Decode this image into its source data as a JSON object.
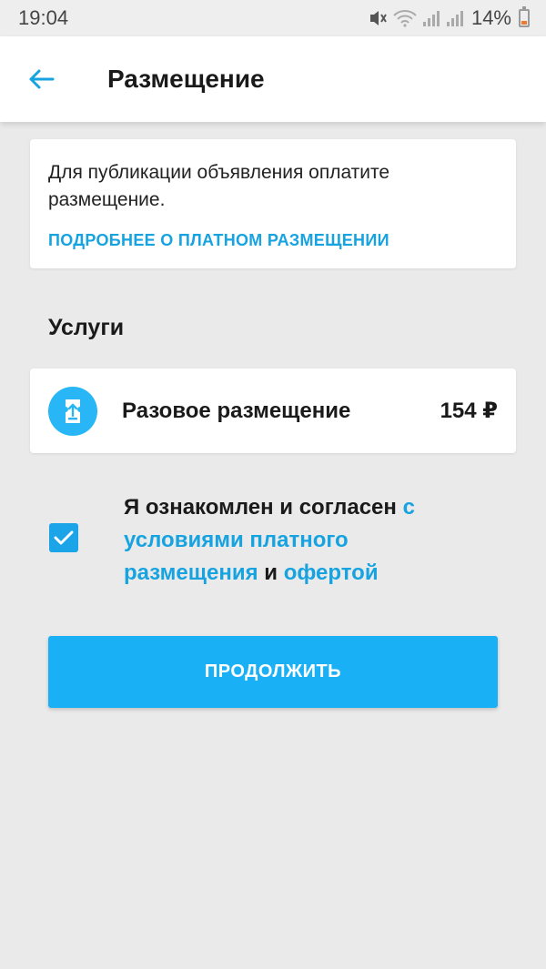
{
  "status_bar": {
    "time": "19:04",
    "battery": "14%",
    "icons": [
      "mute-vibrate-icon",
      "wifi-icon",
      "signal-icon",
      "signal-icon"
    ]
  },
  "header": {
    "title": "Размещение",
    "back_icon": "arrow-left-icon"
  },
  "info_card": {
    "text": "Для публикации объявления оплатите размещение.",
    "link": "ПОДРОБНЕЕ О ПЛАТНОМ РАЗМЕЩЕНИИ"
  },
  "services": {
    "title": "Услуги",
    "items": [
      {
        "icon": "ticket-up-icon",
        "name": "Разовое размещение",
        "price": "154 ₽"
      }
    ]
  },
  "agreement": {
    "checked": true,
    "text_start": "Я ознакомлен и согласен ",
    "link_terms": "с условиями платного размещения",
    "text_and": " и ",
    "link_offer": "офертой"
  },
  "actions": {
    "continue_label": "ПРОДОЛЖИТЬ"
  },
  "colors": {
    "accent": "#1ab0f5",
    "link": "#16a3e0",
    "background": "#eaeaea"
  }
}
